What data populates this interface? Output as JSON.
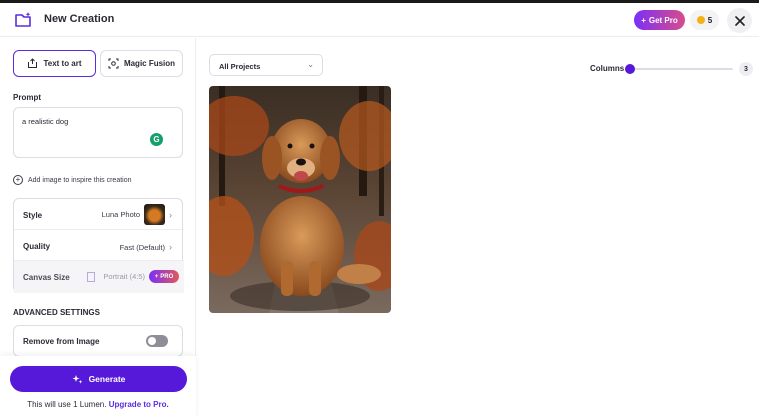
{
  "header": {
    "title": "New Creation",
    "get_pro_label": "Get Pro",
    "credits": "5"
  },
  "tabs": [
    {
      "label": "Text to art",
      "active": true
    },
    {
      "label": "Magic Fusion",
      "active": false
    }
  ],
  "prompt": {
    "label": "Prompt",
    "value": "a realistic dog"
  },
  "add_image_label": "Add image to inspire this creation",
  "settings": {
    "style": {
      "label": "Style",
      "value": "Luna Photo"
    },
    "quality": {
      "label": "Quality",
      "value": "Fast (Default)"
    },
    "canvas": {
      "label": "Canvas Size",
      "value": "Portrait (4:5)",
      "badge": "PRO"
    }
  },
  "advanced": {
    "title": "ADVANCED SETTINGS",
    "remove_label": "Remove from Image",
    "remove_enabled": false
  },
  "generate": {
    "label": "Generate",
    "note_prefix": "This will use 1 Lumen.",
    "note_link": "Upgrade to Pro."
  },
  "gallery": {
    "project_filter": "All Projects",
    "columns_label": "Columns",
    "columns_value": "3"
  },
  "colors": {
    "accent": "#5719d9",
    "pro_gradient_start": "#7b2ff7",
    "pro_gradient_end": "#d84c8c"
  }
}
